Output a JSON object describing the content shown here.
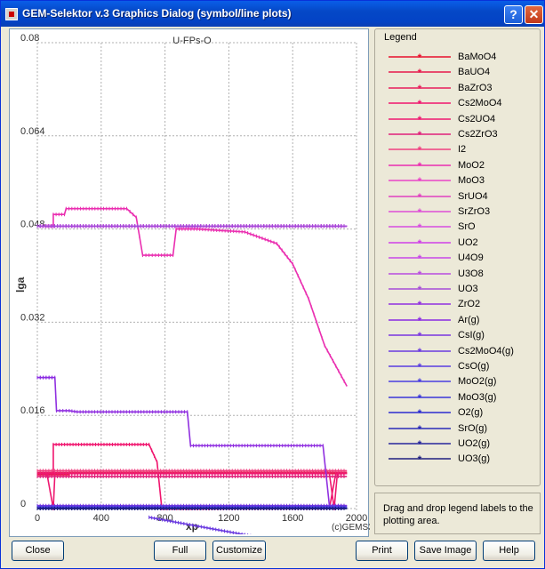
{
  "window": {
    "title": "GEM-Selektor v.3 Graphics Dialog (symbol/line plots)",
    "help_label": "?",
    "close_label": "✕"
  },
  "chart_data": {
    "type": "line",
    "title": "U-FPs-O",
    "xlabel": "xp",
    "ylabel": "lga",
    "copyright": "(c)GEMS3",
    "xlim": [
      0,
      2000
    ],
    "ylim": [
      0,
      0.08
    ],
    "xticks": [
      "0",
      "400",
      "800",
      "1200",
      "1600",
      "2000"
    ],
    "yticks": [
      "0",
      "0.016",
      "0.032",
      "0.048",
      "0.064",
      "0.08"
    ],
    "grid": true,
    "series": [
      {
        "name": "BaMoO4",
        "color": "#e8102c",
        "points": [
          [
            0,
            0.0058
          ],
          [
            200,
            0.0058
          ],
          [
            200,
            0.0062
          ],
          [
            1800,
            0.0062
          ],
          [
            1940,
            0.0062
          ]
        ]
      },
      {
        "name": "BaUO4",
        "color": "#e6194b",
        "points": [
          [
            0,
            0.006
          ],
          [
            1940,
            0.006
          ]
        ]
      },
      {
        "name": "BaZrO3",
        "color": "#e81c5a",
        "points": [
          [
            0,
            0.0062
          ],
          [
            1940,
            0.0062
          ]
        ]
      },
      {
        "name": "Cs2MoO4",
        "color": "#f0156e",
        "points": [
          [
            0,
            0.006
          ],
          [
            100,
            0.006
          ],
          [
            100,
            0.011
          ],
          [
            400,
            0.011
          ],
          [
            700,
            0.011
          ],
          [
            750,
            0.008
          ],
          [
            780,
            0
          ],
          [
            1000,
            0
          ],
          [
            1200,
            0
          ],
          [
            1830,
            0
          ],
          [
            1870,
            0.006
          ],
          [
            1940,
            0.006
          ]
        ]
      },
      {
        "name": "Cs2UO4",
        "color": "#ee1870",
        "points": [
          [
            0,
            0.006
          ],
          [
            60,
            0.006
          ],
          [
            100,
            0
          ],
          [
            110,
            0.006
          ],
          [
            1830,
            0.006
          ],
          [
            1860,
            0
          ],
          [
            1880,
            0.006
          ],
          [
            1940,
            0.006
          ]
        ]
      },
      {
        "name": "Cs2ZrO3",
        "color": "#e0207a",
        "points": [
          [
            0,
            0.0055
          ],
          [
            1940,
            0.0055
          ]
        ]
      },
      {
        "name": "I2",
        "color": "#f04080",
        "points": [
          [
            0,
            0.0065
          ],
          [
            1940,
            0.0065
          ]
        ]
      },
      {
        "name": "MoO2",
        "color": "#ea2eb0",
        "points": [
          [
            0,
            0.0485
          ],
          [
            100,
            0.0485
          ],
          [
            100,
            0.0505
          ],
          [
            170,
            0.0505
          ],
          [
            180,
            0.0515
          ],
          [
            560,
            0.0515
          ],
          [
            620,
            0.05
          ],
          [
            660,
            0.0435
          ],
          [
            720,
            0.0435
          ],
          [
            760,
            0.0435
          ],
          [
            850,
            0.0435
          ],
          [
            870,
            0.048
          ],
          [
            1000,
            0.048
          ],
          [
            1300,
            0.0475
          ],
          [
            1500,
            0.0455
          ],
          [
            1600,
            0.042
          ],
          [
            1700,
            0.036
          ],
          [
            1800,
            0.028
          ],
          [
            1940,
            0.021
          ]
        ]
      },
      {
        "name": "MoO3",
        "color": "#ea44c8",
        "points": [
          [
            0,
            0.0485
          ],
          [
            1940,
            0.0485
          ]
        ]
      },
      {
        "name": "SrUO4",
        "color": "#e040c0",
        "points": [
          [
            0,
            0.0485
          ],
          [
            1940,
            0.0485
          ]
        ]
      },
      {
        "name": "SrZrO3",
        "color": "#dd4ed6",
        "points": [
          [
            0,
            0.0485
          ],
          [
            1940,
            0.0485
          ]
        ]
      },
      {
        "name": "SrO",
        "color": "#d64ce0",
        "points": [
          [
            0,
            0.0485
          ],
          [
            1940,
            0.0485
          ]
        ]
      },
      {
        "name": "UO2",
        "color": "#d040e8",
        "points": [
          [
            0,
            0.0485
          ],
          [
            1940,
            0.0485
          ]
        ]
      },
      {
        "name": "U4O9",
        "color": "#c848e8",
        "points": [
          [
            0,
            0.0485
          ],
          [
            1940,
            0.0485
          ]
        ]
      },
      {
        "name": "U3O8",
        "color": "#b84ce0",
        "points": [
          [
            0,
            0.0485
          ],
          [
            1940,
            0.0485
          ]
        ]
      },
      {
        "name": "UO3",
        "color": "#a64cd8",
        "points": [
          [
            0,
            0.0485
          ],
          [
            1940,
            0.0485
          ]
        ]
      },
      {
        "name": "ZrO2",
        "color": "#9030e0",
        "points": [
          [
            0,
            0.0225
          ],
          [
            110,
            0.0225
          ],
          [
            120,
            0.0168
          ],
          [
            200,
            0.0168
          ],
          [
            250,
            0.0166
          ],
          [
            940,
            0.0166
          ],
          [
            960,
            0.0108
          ],
          [
            1300,
            0.0108
          ],
          [
            1790,
            0.0108
          ],
          [
            1830,
            0.0005
          ],
          [
            1940,
            0.0005
          ]
        ]
      },
      {
        "name": "Ar(g)",
        "color": "#8a2be2",
        "points": [
          [
            0,
            0.0225
          ],
          [
            110,
            0.0225
          ]
        ]
      },
      {
        "name": "CsI(g)",
        "color": "#7a36e0",
        "points": [
          [
            0,
            0.0005
          ],
          [
            1940,
            0.0005
          ]
        ]
      },
      {
        "name": "Cs2MoO4(g)",
        "color": "#6a3ae0",
        "points": [
          [
            700,
            -0.0015
          ],
          [
            800,
            -0.002
          ],
          [
            900,
            -0.0025
          ],
          [
            1100,
            -0.0035
          ],
          [
            1300,
            -0.0045
          ],
          [
            1500,
            -0.0055
          ],
          [
            1600,
            -0.0058
          ]
        ]
      },
      {
        "name": "CsO(g)",
        "color": "#5a3ee0",
        "points": [
          [
            0,
            0.0003
          ],
          [
            1940,
            0.0003
          ]
        ]
      },
      {
        "name": "MoO2(g)",
        "color": "#4a3ee0",
        "points": [
          [
            0,
            0.0002
          ],
          [
            1940,
            0.0002
          ]
        ]
      },
      {
        "name": "MoO3(g)",
        "color": "#3a36d8",
        "points": [
          [
            0,
            0.0001
          ],
          [
            1940,
            0.0001
          ]
        ]
      },
      {
        "name": "O2(g)",
        "color": "#2c2cd0",
        "points": [
          [
            0,
            0
          ],
          [
            1940,
            0
          ]
        ]
      },
      {
        "name": "SrO(g)",
        "color": "#2a2ab8",
        "points": [
          [
            0,
            0
          ],
          [
            1940,
            0
          ]
        ]
      },
      {
        "name": "UO2(g)",
        "color": "#26269c",
        "points": [
          [
            0,
            0
          ],
          [
            1940,
            0
          ]
        ]
      },
      {
        "name": "UO3(g)",
        "color": "#202080",
        "points": [
          [
            0,
            0
          ],
          [
            1940,
            0
          ]
        ]
      }
    ]
  },
  "legend": {
    "title": "Legend",
    "marker": "*"
  },
  "hint": {
    "text": "Drag and drop legend labels to the plotting area."
  },
  "buttons": {
    "close": "Close",
    "full": "Full",
    "customize": "Customize",
    "print": "Print",
    "save_image": "Save Image",
    "help": "Help"
  }
}
